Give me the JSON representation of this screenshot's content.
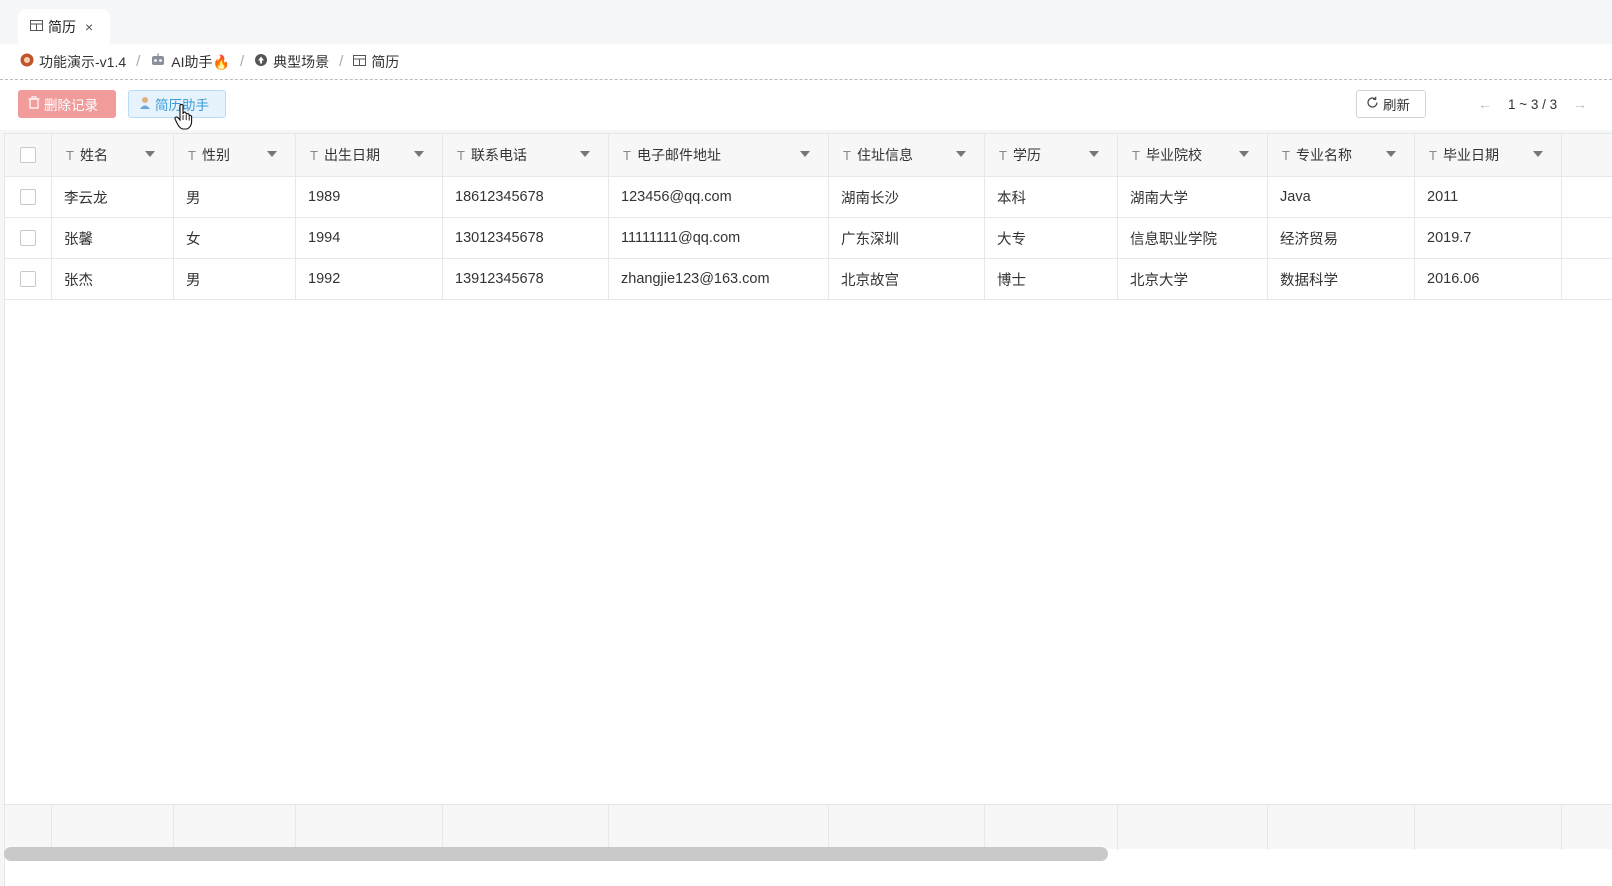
{
  "tab": {
    "label": "简历",
    "icon": "table-icon",
    "close": "×"
  },
  "breadcrumb": [
    {
      "label": "功能演示-v1.4",
      "icon": "app-logo-icon"
    },
    {
      "label": "AI助手🔥",
      "icon": "robot-icon"
    },
    {
      "label": "典型场景",
      "icon": "circle-up-icon"
    },
    {
      "label": "简历",
      "icon": "table-icon"
    }
  ],
  "breadcrumb_separator": "/",
  "toolbar": {
    "delete_label": "删除记录",
    "assistant_label": "简历助手",
    "refresh_label": "刷新",
    "pager_range": "1 ~ 3 / 3",
    "prev_arrow": "←",
    "next_arrow": "→"
  },
  "colors": {
    "delete_bg": "#f19b9b",
    "assistant_bg": "#e6f3fc",
    "assistant_text": "#3a9ad9"
  },
  "table": {
    "type_glyph": "T",
    "columns": [
      "姓名",
      "性别",
      "出生日期",
      "联系电话",
      "电子邮件地址",
      "住址信息",
      "学历",
      "毕业院校",
      "专业名称",
      "毕业日期"
    ],
    "rows": [
      [
        "李云龙",
        "男",
        "1989",
        "18612345678",
        "123456@qq.com",
        "湖南长沙",
        "本科",
        "湖南大学",
        "Java",
        "2011"
      ],
      [
        "张馨",
        "女",
        "1994",
        "13012345678",
        "11111111@qq.com",
        "广东深圳",
        "大专",
        "信息职业学院",
        "经济贸易",
        "2019.7"
      ],
      [
        "张杰",
        "男",
        "1992",
        "13912345678",
        "zhangjie123@163.com",
        "北京故宫",
        "博士",
        "北京大学",
        "数据科学",
        "2016.06"
      ]
    ]
  }
}
